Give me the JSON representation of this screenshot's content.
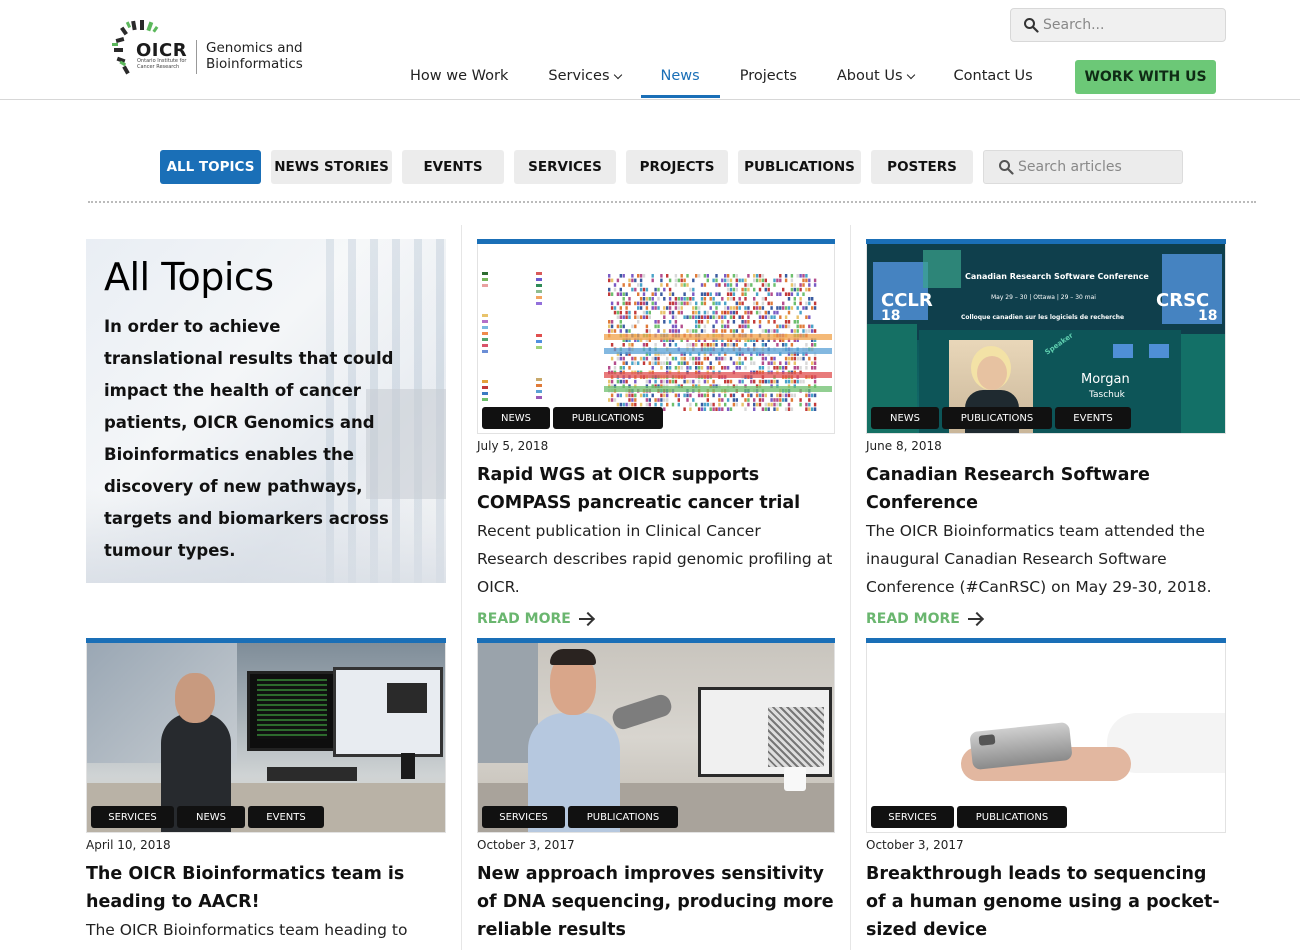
{
  "header": {
    "logo_text": "OICR",
    "logo_sub": "Ontario Institute for Cancer Research",
    "site_name": "Genomics and Bioinformatics",
    "search_placeholder": "Search...",
    "nav": [
      {
        "label": "How we Work",
        "dropdown": false,
        "active": false
      },
      {
        "label": "Services",
        "dropdown": true,
        "active": false
      },
      {
        "label": "News",
        "dropdown": false,
        "active": true
      },
      {
        "label": "Projects",
        "dropdown": false,
        "active": false
      },
      {
        "label": "About Us",
        "dropdown": true,
        "active": false
      },
      {
        "label": "Contact Us",
        "dropdown": false,
        "active": false
      }
    ],
    "cta_label": "WORK WITH US"
  },
  "filters": {
    "items": [
      "ALL TOPICS",
      "NEWS STORIES",
      "EVENTS",
      "SERVICES",
      "PROJECTS",
      "PUBLICATIONS",
      "POSTERS"
    ],
    "active": "ALL TOPICS",
    "search_placeholder": "Search articles"
  },
  "intro": {
    "heading": "All Topics",
    "text": "In order to achieve translational results that could impact the health of cancer patients, OICR Genomics and Bioinformatics enables the discovery of new pathways, targets and biomarkers across tumour types."
  },
  "cards": [
    {
      "tags": [
        "NEWS",
        "PUBLICATIONS"
      ],
      "date": "July 5, 2018",
      "title": "Rapid WGS at OICR supports COMPASS pancreatic cancer trial",
      "desc": "Recent publication in Clinical Cancer Research describes rapid genomic profiling at OICR.",
      "more": "READ MORE"
    },
    {
      "tags": [
        "NEWS",
        "PUBLICATIONS",
        "EVENTS"
      ],
      "date": "June 8, 2018",
      "title": "Canadian Research Software Conference",
      "desc": "The OICR Bioinformatics team attended the inaugural Canadian Research Software Conference (#CanRSC) on May 29-30, 2018.",
      "more": "READ MORE",
      "image_text": {
        "conf_title": "Canadian Research Software Conference",
        "conf_dates": "May 29 – 30 | Ottawa | 29 – 30 mai",
        "conf_fr": "Colloque canadien sur les logiciels de recherche",
        "left_badge": "CCLR",
        "left_num": "18",
        "right_badge": "CRSC",
        "right_num": "18",
        "speaker_ribbon": "Speaker",
        "speaker_first": "Morgan",
        "speaker_last": "Taschuk"
      }
    },
    {
      "tags": [
        "SERVICES",
        "NEWS",
        "EVENTS"
      ],
      "date": "April 10, 2018",
      "title": "The OICR Bioinformatics team is heading to AACR!",
      "desc": "The OICR Bioinformatics team heading to AACR"
    },
    {
      "tags": [
        "SERVICES",
        "PUBLICATIONS"
      ],
      "date": "October 3, 2017",
      "title": "New approach improves sensitivity of DNA sequencing, producing more reliable results",
      "desc": ""
    },
    {
      "tags": [
        "SERVICES",
        "PUBLICATIONS"
      ],
      "date": "October 3, 2017",
      "title": "Breakthrough leads to sequencing of a human genome using a pocket-sized device",
      "desc": ""
    }
  ],
  "colors": {
    "brand_blue": "#1a6fb7",
    "cta_green": "#6cc877",
    "read_more_green": "#6ab66f"
  }
}
